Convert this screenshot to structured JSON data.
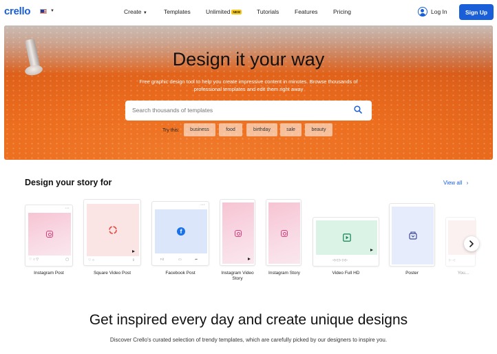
{
  "brand": {
    "logo_text": "crello",
    "accent": "#1a5fd8"
  },
  "header": {
    "nav": {
      "create": "Create",
      "templates": "Templates",
      "unlimited": "Unlimited",
      "unlimited_badge": "NEW",
      "tutorials": "Tutorials",
      "features": "Features",
      "pricing": "Pricing"
    },
    "login_label": "Log In",
    "signup_label": "Sign Up"
  },
  "hero": {
    "title": "Design it your way",
    "subtitle_line1": "Free graphic design tool to help you create impressive content in minutes. Browse thousands of",
    "subtitle_line2": "professional templates and edit them right away",
    "search_placeholder": "Search thousands of templates",
    "try_label": "Try this:",
    "tags": [
      "business",
      "food",
      "birthday",
      "sale",
      "beauty"
    ]
  },
  "story": {
    "title": "Design your story for",
    "view_all": "View all",
    "cards": [
      {
        "label": "Instagram Post"
      },
      {
        "label": "Square Video Post"
      },
      {
        "label": "Facebook Post"
      },
      {
        "label_line1": "Instagram Video",
        "label_line2": "Story"
      },
      {
        "label": "Instagram Story"
      },
      {
        "label": "Video Full HD"
      },
      {
        "label": "Poster"
      },
      {
        "label": "You..."
      }
    ]
  },
  "inspire": {
    "title": "Get inspired every day and create unique designs",
    "subtitle": "Discover Crello's curated selection of trendy templates, which are carefully picked by our designers to inspire you."
  }
}
